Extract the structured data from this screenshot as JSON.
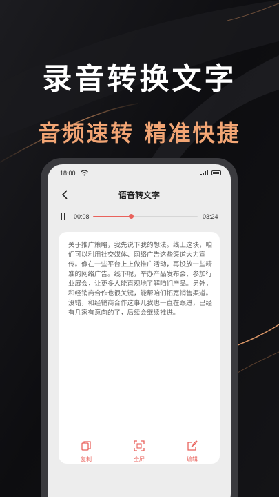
{
  "hero": {
    "headline": "录音转换文字",
    "subline": "音频速转 精准快捷"
  },
  "status_bar": {
    "time": "18:00"
  },
  "nav": {
    "title": "语音转文字"
  },
  "player": {
    "current_time": "00:08",
    "total_time": "03:24",
    "progress": 0.36
  },
  "transcript": {
    "text": "关于推广策略，我先说下我的想法。线上这块，咱们可以利用社交媒体、网络广告这些渠道大力宣传。像在一些平台上上做推广活动，再投放一些精准的网络广告。线下呢，举办产品发布会、参加行业展会，让更多人能直观地了解咱们产品。另外，和经销商合作也很关键，能帮咱们拓宽销售渠道。\n没错，和经销商合作这事儿我也一直在跟进，已经有几家有意向的了，后续会继续推进。"
  },
  "actions": {
    "copy_label": "复制",
    "fullscreen_label": "全屏",
    "edit_label": "编辑"
  },
  "colors": {
    "accent": "#e9625c",
    "subline": "#f2a574",
    "background": "#0b0b0d"
  }
}
